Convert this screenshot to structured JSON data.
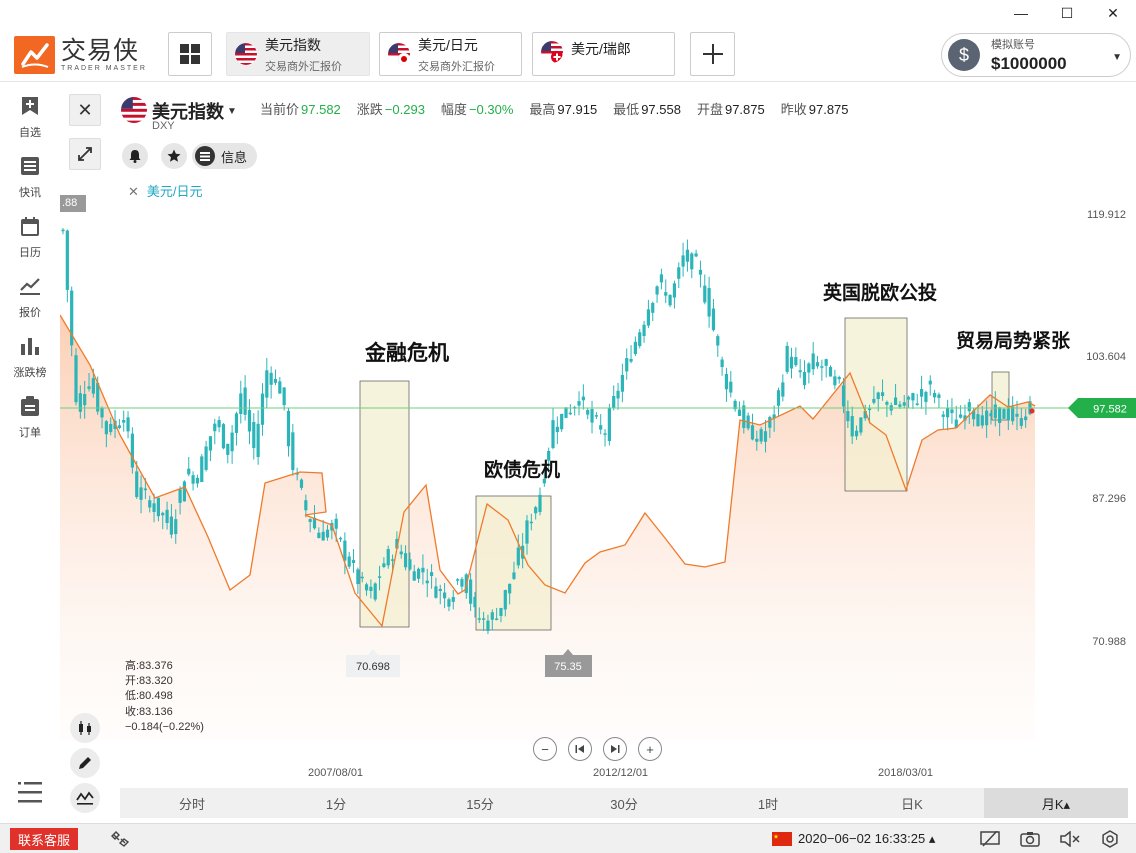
{
  "window": {
    "minimize": "—",
    "maximize": "☐",
    "close": "✕"
  },
  "logo": {
    "cn": "交易侠",
    "en": "TRADER MASTER"
  },
  "tabs": [
    {
      "title": "美元指数",
      "sub": "交易商外汇报价",
      "flag": "us"
    },
    {
      "title": "美元/日元",
      "sub": "交易商外汇报价",
      "flag": "us-jp"
    },
    {
      "title": "美元/瑞郎",
      "sub": "",
      "flag": "us-ch"
    }
  ],
  "account": {
    "label": "模拟账号",
    "value": "$1000000"
  },
  "sidebar": [
    {
      "label": "自选",
      "icon": "bookmark-add-icon"
    },
    {
      "label": "快讯",
      "icon": "news-list-icon"
    },
    {
      "label": "日历",
      "icon": "calendar-icon"
    },
    {
      "label": "报价",
      "icon": "line-chart-icon"
    },
    {
      "label": "涨跌榜",
      "icon": "bar-ranking-icon"
    },
    {
      "label": "订单",
      "icon": "clipboard-icon"
    }
  ],
  "instrument": {
    "name": "美元指数",
    "code": "DXY",
    "quotes": [
      {
        "label": "当前价",
        "value": "97.582",
        "color": "green"
      },
      {
        "label": "涨跌",
        "value": "−0.293",
        "color": "green"
      },
      {
        "label": "幅度",
        "value": "−0.30%",
        "color": "green"
      },
      {
        "label": "最高",
        "value": "97.915",
        "color": "dark"
      },
      {
        "label": "最低",
        "value": "97.558",
        "color": "dark"
      },
      {
        "label": "开盘",
        "value": "97.875",
        "color": "dark"
      },
      {
        "label": "昨收",
        "value": "97.875",
        "color": "dark"
      }
    ],
    "info_label": "信息",
    "compare_label": "美元/日元"
  },
  "chart_data": {
    "type": "line",
    "title": "",
    "ylabel": "",
    "y_ticks": [
      "119.912",
      "103.604",
      "87.296",
      "70.988"
    ],
    "x_ticks": [
      "2007/08/01",
      "2012/12/01",
      "2018/03/01"
    ],
    "current_price": "97.582",
    "top_left_marker": ".88",
    "low_markers": [
      "70.698",
      "75.35"
    ],
    "annotations": [
      "金融危机",
      "欧债危机",
      "英国脱欧公投",
      "贸易局势紧张"
    ],
    "series": [
      {
        "name": "美元指数"
      },
      {
        "name": "美元/日元"
      }
    ]
  },
  "ohlc": {
    "high": "高:83.376",
    "open": "开:83.320",
    "low": "低:80.498",
    "close": "收:83.136",
    "change": "−0.184(−0.22%)"
  },
  "periods": [
    "分时",
    "1分",
    "15分",
    "30分",
    "1时",
    "日K",
    "月K▴"
  ],
  "status": {
    "service": "联系客服",
    "datetime": "2020−06−02 16:33:25 ▴"
  },
  "colors": {
    "accent": "#f26722",
    "up": "#23b04a",
    "candle": "#2bb5b8",
    "line": "#f07a2a"
  }
}
